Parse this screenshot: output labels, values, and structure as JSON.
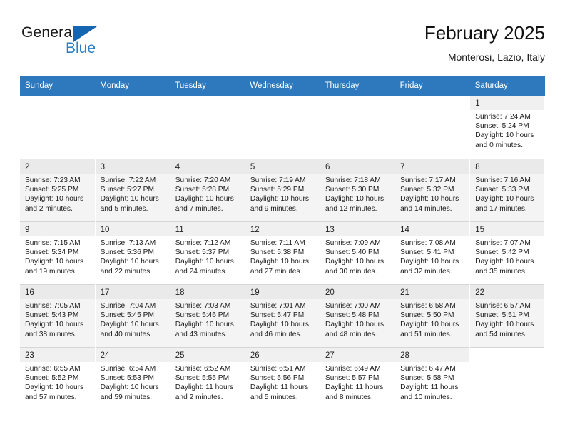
{
  "brand": {
    "name_top": "General",
    "name_bottom": "Blue",
    "accent_color": "#2a7fc9",
    "triangle_color": "#1565b0"
  },
  "header": {
    "title": "February 2025",
    "subtitle": "Monterosi, Lazio, Italy"
  },
  "table": {
    "header_bg": "#2e79bd",
    "columns": [
      "Sunday",
      "Monday",
      "Tuesday",
      "Wednesday",
      "Thursday",
      "Friday",
      "Saturday"
    ]
  },
  "weeks": [
    {
      "alt": false,
      "days": [
        {
          "empty": true
        },
        {
          "empty": true
        },
        {
          "empty": true
        },
        {
          "empty": true
        },
        {
          "empty": true
        },
        {
          "empty": true
        },
        {
          "day": "1",
          "sunrise": "Sunrise: 7:24 AM",
          "sunset": "Sunset: 5:24 PM",
          "daylight_line1": "Daylight: 10 hours",
          "daylight_line2": "and 0 minutes."
        }
      ]
    },
    {
      "alt": true,
      "days": [
        {
          "day": "2",
          "sunrise": "Sunrise: 7:23 AM",
          "sunset": "Sunset: 5:25 PM",
          "daylight_line1": "Daylight: 10 hours",
          "daylight_line2": "and 2 minutes."
        },
        {
          "day": "3",
          "sunrise": "Sunrise: 7:22 AM",
          "sunset": "Sunset: 5:27 PM",
          "daylight_line1": "Daylight: 10 hours",
          "daylight_line2": "and 5 minutes."
        },
        {
          "day": "4",
          "sunrise": "Sunrise: 7:20 AM",
          "sunset": "Sunset: 5:28 PM",
          "daylight_line1": "Daylight: 10 hours",
          "daylight_line2": "and 7 minutes."
        },
        {
          "day": "5",
          "sunrise": "Sunrise: 7:19 AM",
          "sunset": "Sunset: 5:29 PM",
          "daylight_line1": "Daylight: 10 hours",
          "daylight_line2": "and 9 minutes."
        },
        {
          "day": "6",
          "sunrise": "Sunrise: 7:18 AM",
          "sunset": "Sunset: 5:30 PM",
          "daylight_line1": "Daylight: 10 hours",
          "daylight_line2": "and 12 minutes."
        },
        {
          "day": "7",
          "sunrise": "Sunrise: 7:17 AM",
          "sunset": "Sunset: 5:32 PM",
          "daylight_line1": "Daylight: 10 hours",
          "daylight_line2": "and 14 minutes."
        },
        {
          "day": "8",
          "sunrise": "Sunrise: 7:16 AM",
          "sunset": "Sunset: 5:33 PM",
          "daylight_line1": "Daylight: 10 hours",
          "daylight_line2": "and 17 minutes."
        }
      ]
    },
    {
      "alt": false,
      "days": [
        {
          "day": "9",
          "sunrise": "Sunrise: 7:15 AM",
          "sunset": "Sunset: 5:34 PM",
          "daylight_line1": "Daylight: 10 hours",
          "daylight_line2": "and 19 minutes."
        },
        {
          "day": "10",
          "sunrise": "Sunrise: 7:13 AM",
          "sunset": "Sunset: 5:36 PM",
          "daylight_line1": "Daylight: 10 hours",
          "daylight_line2": "and 22 minutes."
        },
        {
          "day": "11",
          "sunrise": "Sunrise: 7:12 AM",
          "sunset": "Sunset: 5:37 PM",
          "daylight_line1": "Daylight: 10 hours",
          "daylight_line2": "and 24 minutes."
        },
        {
          "day": "12",
          "sunrise": "Sunrise: 7:11 AM",
          "sunset": "Sunset: 5:38 PM",
          "daylight_line1": "Daylight: 10 hours",
          "daylight_line2": "and 27 minutes."
        },
        {
          "day": "13",
          "sunrise": "Sunrise: 7:09 AM",
          "sunset": "Sunset: 5:40 PM",
          "daylight_line1": "Daylight: 10 hours",
          "daylight_line2": "and 30 minutes."
        },
        {
          "day": "14",
          "sunrise": "Sunrise: 7:08 AM",
          "sunset": "Sunset: 5:41 PM",
          "daylight_line1": "Daylight: 10 hours",
          "daylight_line2": "and 32 minutes."
        },
        {
          "day": "15",
          "sunrise": "Sunrise: 7:07 AM",
          "sunset": "Sunset: 5:42 PM",
          "daylight_line1": "Daylight: 10 hours",
          "daylight_line2": "and 35 minutes."
        }
      ]
    },
    {
      "alt": true,
      "days": [
        {
          "day": "16",
          "sunrise": "Sunrise: 7:05 AM",
          "sunset": "Sunset: 5:43 PM",
          "daylight_line1": "Daylight: 10 hours",
          "daylight_line2": "and 38 minutes."
        },
        {
          "day": "17",
          "sunrise": "Sunrise: 7:04 AM",
          "sunset": "Sunset: 5:45 PM",
          "daylight_line1": "Daylight: 10 hours",
          "daylight_line2": "and 40 minutes."
        },
        {
          "day": "18",
          "sunrise": "Sunrise: 7:03 AM",
          "sunset": "Sunset: 5:46 PM",
          "daylight_line1": "Daylight: 10 hours",
          "daylight_line2": "and 43 minutes."
        },
        {
          "day": "19",
          "sunrise": "Sunrise: 7:01 AM",
          "sunset": "Sunset: 5:47 PM",
          "daylight_line1": "Daylight: 10 hours",
          "daylight_line2": "and 46 minutes."
        },
        {
          "day": "20",
          "sunrise": "Sunrise: 7:00 AM",
          "sunset": "Sunset: 5:48 PM",
          "daylight_line1": "Daylight: 10 hours",
          "daylight_line2": "and 48 minutes."
        },
        {
          "day": "21",
          "sunrise": "Sunrise: 6:58 AM",
          "sunset": "Sunset: 5:50 PM",
          "daylight_line1": "Daylight: 10 hours",
          "daylight_line2": "and 51 minutes."
        },
        {
          "day": "22",
          "sunrise": "Sunrise: 6:57 AM",
          "sunset": "Sunset: 5:51 PM",
          "daylight_line1": "Daylight: 10 hours",
          "daylight_line2": "and 54 minutes."
        }
      ]
    },
    {
      "alt": false,
      "days": [
        {
          "day": "23",
          "sunrise": "Sunrise: 6:55 AM",
          "sunset": "Sunset: 5:52 PM",
          "daylight_line1": "Daylight: 10 hours",
          "daylight_line2": "and 57 minutes."
        },
        {
          "day": "24",
          "sunrise": "Sunrise: 6:54 AM",
          "sunset": "Sunset: 5:53 PM",
          "daylight_line1": "Daylight: 10 hours",
          "daylight_line2": "and 59 minutes."
        },
        {
          "day": "25",
          "sunrise": "Sunrise: 6:52 AM",
          "sunset": "Sunset: 5:55 PM",
          "daylight_line1": "Daylight: 11 hours",
          "daylight_line2": "and 2 minutes."
        },
        {
          "day": "26",
          "sunrise": "Sunrise: 6:51 AM",
          "sunset": "Sunset: 5:56 PM",
          "daylight_line1": "Daylight: 11 hours",
          "daylight_line2": "and 5 minutes."
        },
        {
          "day": "27",
          "sunrise": "Sunrise: 6:49 AM",
          "sunset": "Sunset: 5:57 PM",
          "daylight_line1": "Daylight: 11 hours",
          "daylight_line2": "and 8 minutes."
        },
        {
          "day": "28",
          "sunrise": "Sunrise: 6:47 AM",
          "sunset": "Sunset: 5:58 PM",
          "daylight_line1": "Daylight: 11 hours",
          "daylight_line2": "and 10 minutes."
        },
        {
          "empty": true
        }
      ]
    }
  ]
}
